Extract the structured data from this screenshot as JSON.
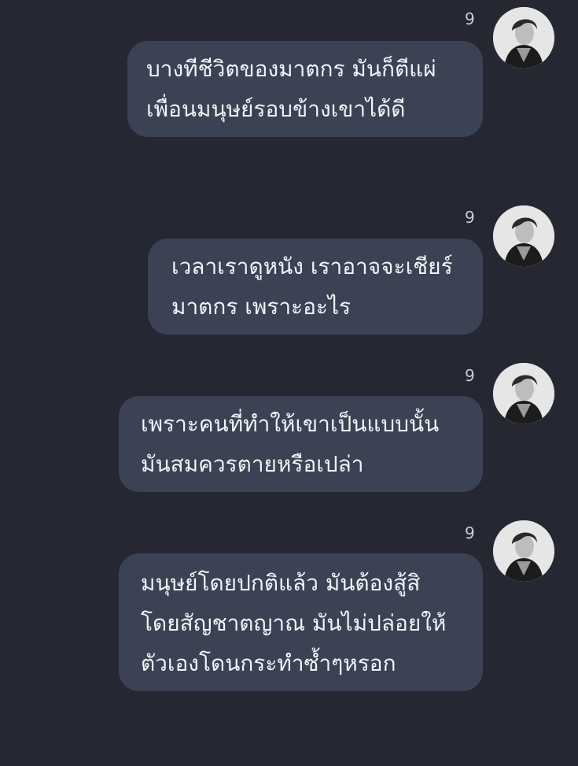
{
  "messages": [
    {
      "sender": "9",
      "lines": [
        "บางทีชีวิตของมาตกร มันก็ตีแผ่",
        "เพื่อนมนุษย์รอบข้างเขาได้ดี"
      ]
    },
    {
      "sender": "9",
      "lines": [
        "เวลาเราดูหนัง เราอาจจะเชียร์",
        "มาตกร เพราะอะไร"
      ]
    },
    {
      "sender": "9",
      "lines": [
        "เพราะคนที่ทำให้เขาเป็นแบบนั้น",
        "มันสมควรตายหรือเปล่า"
      ]
    },
    {
      "sender": "9",
      "lines": [
        "มนุษย์โดยปกติแล้ว มันต้องสู้สิ",
        "โดยสัญชาตญาณ มันไม่ปล่อยให้",
        "ตัวเองโดนกระทำซ้ำๆหรอก"
      ]
    }
  ],
  "colors": {
    "background": "#252833",
    "bubble": "#3b4254",
    "text": "#f2f3f6"
  }
}
